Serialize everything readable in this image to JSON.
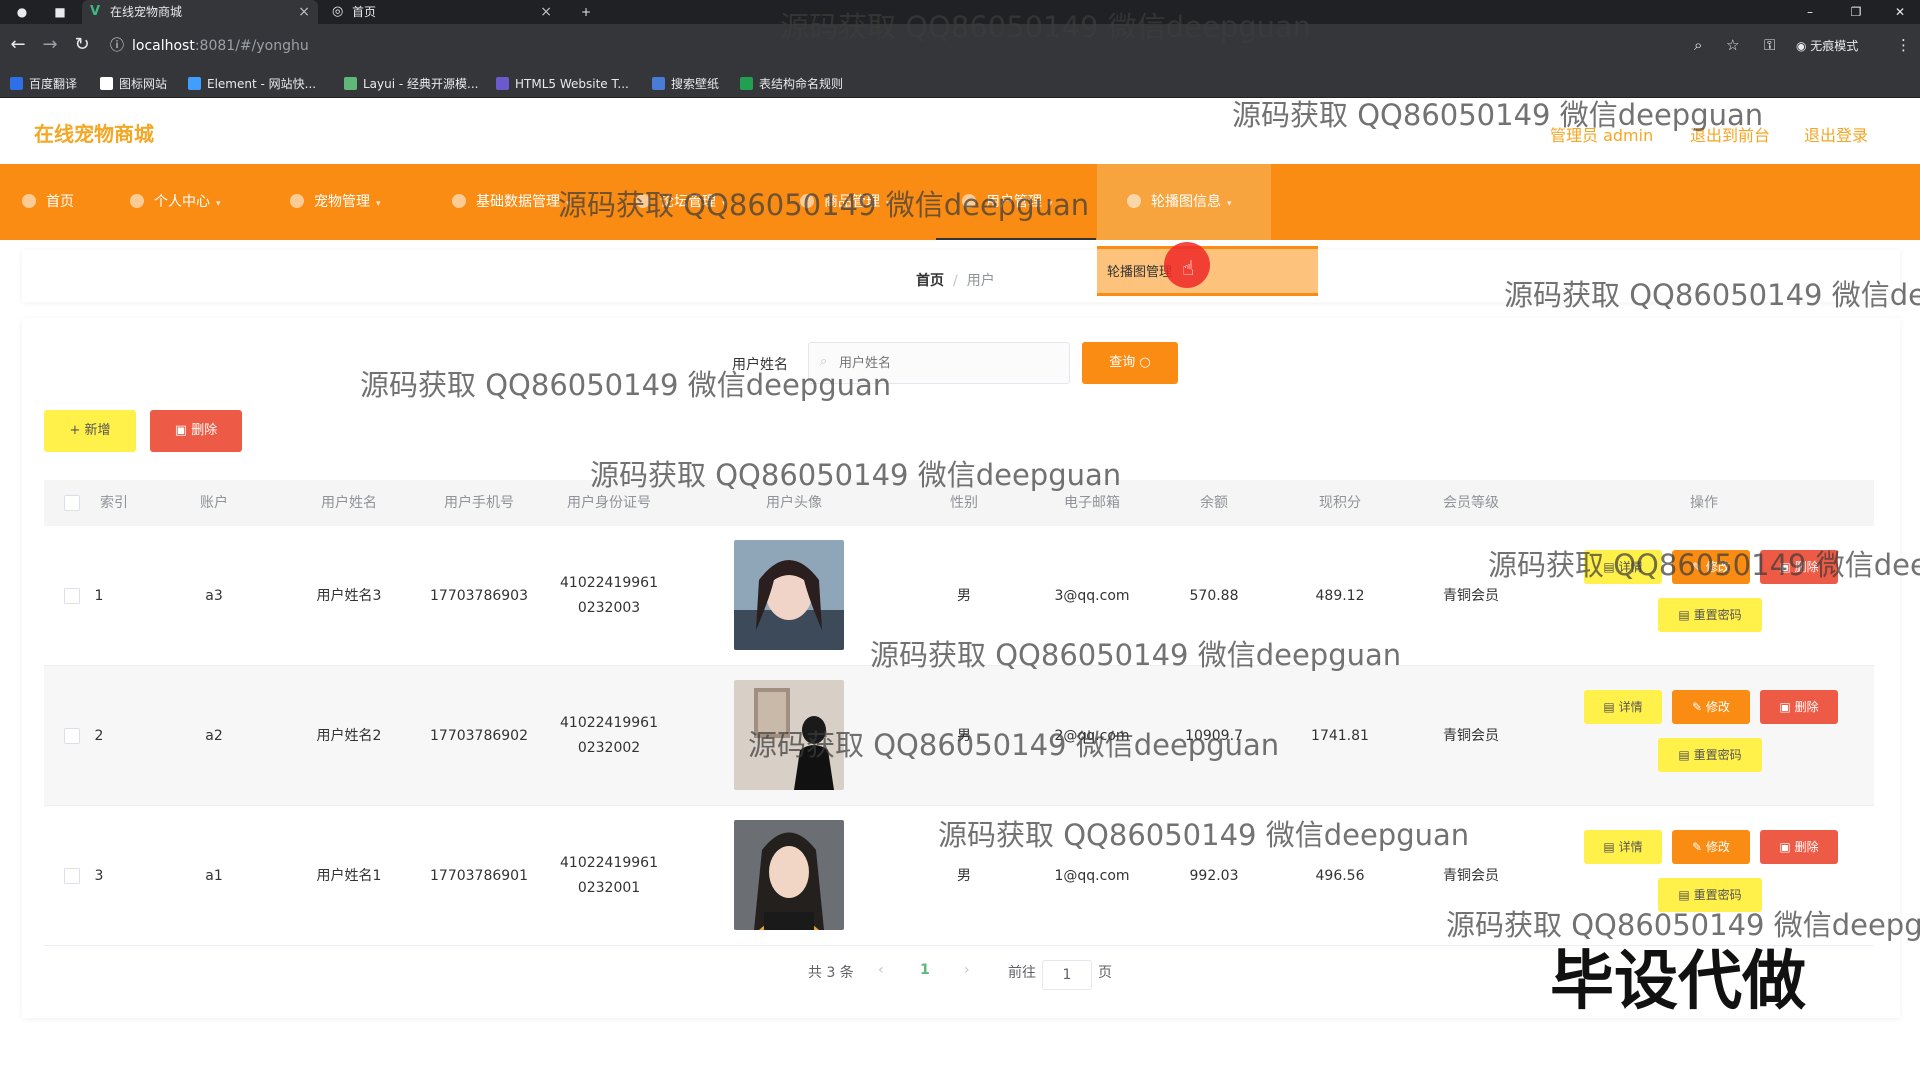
{
  "browser": {
    "tabs": [
      {
        "title": "在线宠物商城",
        "active": true
      },
      {
        "title": "首页",
        "active": false
      }
    ],
    "url_host": "localhost",
    "url_rest": ":8081/#/yonghu",
    "incognito_label": "无痕模式",
    "bookmarks": [
      {
        "label": "百度翻译",
        "color": "#2f6fe8"
      },
      {
        "label": "图标网站",
        "color": "#ffffff"
      },
      {
        "label": "Element - 网站快...",
        "color": "#409eff"
      },
      {
        "label": "Layui - 经典开源模...",
        "color": "#5fb878"
      },
      {
        "label": "HTML5 Website T...",
        "color": "#6a5acd"
      },
      {
        "label": "搜索壁纸",
        "color": "#4a7bd6"
      },
      {
        "label": "表结构命名规则",
        "color": "#20a050"
      }
    ]
  },
  "header": {
    "logo": "在线宠物商城",
    "user": "管理员 admin",
    "to_front": "退出到前台",
    "logout": "退出登录"
  },
  "nav": [
    {
      "label": "首页"
    },
    {
      "label": "个人中心"
    },
    {
      "label": "宠物管理"
    },
    {
      "label": "基础数据管理"
    },
    {
      "label": "论坛管理"
    },
    {
      "label": "商品管理"
    },
    {
      "label": "用户管理"
    },
    {
      "label": "轮播图信息"
    }
  ],
  "dropdown": {
    "item": "轮播图管理"
  },
  "breadcrumb": {
    "home": "首页",
    "sep": "/",
    "current": "用户"
  },
  "search": {
    "label": "用户姓名",
    "placeholder": "用户姓名",
    "query_button": "查询"
  },
  "toolbar": {
    "add_button": "+ 新增",
    "delete_button": "删除"
  },
  "table": {
    "columns": [
      "索引",
      "账户",
      "用户姓名",
      "用户手机号",
      "用户身份证号",
      "用户头像",
      "性别",
      "电子邮箱",
      "余额",
      "现积分",
      "会员等级",
      "操作"
    ],
    "rows": [
      {
        "index": "1",
        "account": "a3",
        "name": "用户姓名3",
        "phone": "17703786903",
        "id_a": "41022419961",
        "id_b": "0232003",
        "gender": "男",
        "email": "3@qq.com",
        "balance": "570.88",
        "points": "489.12",
        "level": "青铜会员"
      },
      {
        "index": "2",
        "account": "a2",
        "name": "用户姓名2",
        "phone": "17703786902",
        "id_a": "41022419961",
        "id_b": "0232002",
        "gender": "男",
        "email": "2@qq.com",
        "balance": "10909.7",
        "points": "1741.81",
        "level": "青铜会员"
      },
      {
        "index": "3",
        "account": "a1",
        "name": "用户姓名1",
        "phone": "17703786901",
        "id_a": "41022419961",
        "id_b": "0232001",
        "gender": "男",
        "email": "1@qq.com",
        "balance": "992.03",
        "points": "496.56",
        "level": "青铜会员"
      }
    ],
    "actions": {
      "detail": "详情",
      "edit": "修改",
      "remove": "删除",
      "reset": "重置密码"
    }
  },
  "pagination": {
    "total": "共 3 条",
    "current": "1",
    "goto": "前往",
    "page_value": "1",
    "page_suffix": "页"
  },
  "watermark": {
    "text": "源码获取 QQ86050149 微信deepguan",
    "big": "毕设代做"
  }
}
